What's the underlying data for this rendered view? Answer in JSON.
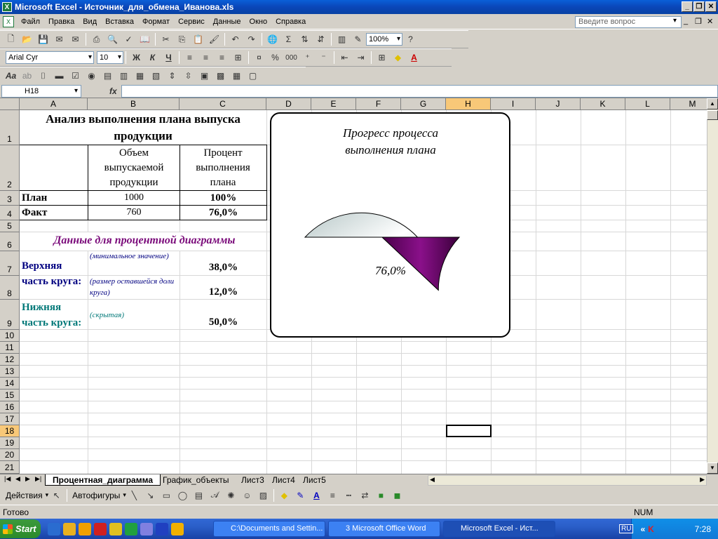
{
  "window": {
    "title": "Microsoft Excel - Источник_для_обмена_Иванова.xls"
  },
  "menu": {
    "items": [
      "Файл",
      "Правка",
      "Вид",
      "Вставка",
      "Формат",
      "Сервис",
      "Данные",
      "Окно",
      "Справка"
    ],
    "help_placeholder": "Введите вопрос"
  },
  "toolbar": {
    "zoom": "100%",
    "font": "Arial Cyr",
    "size": "10",
    "bold": "Ж",
    "italic": "К",
    "underline": "Ч",
    "percent": "%",
    "thousands": "000"
  },
  "formula_bar": {
    "name_box": "H18",
    "fx": "fx",
    "content": ""
  },
  "columns": [
    "A",
    "B",
    "C",
    "D",
    "E",
    "F",
    "G",
    "H",
    "I",
    "J",
    "K",
    "L",
    "M"
  ],
  "rows": [
    "1",
    "2",
    "3",
    "4",
    "5",
    "6",
    "7",
    "8",
    "9",
    "10",
    "11",
    "12",
    "13",
    "14",
    "15",
    "16",
    "17",
    "18",
    "19",
    "20",
    "21"
  ],
  "sheet": {
    "title": "Анализ выполнения плана выпуска продукции",
    "hdr_volume": "Объем выпускаемой продукции",
    "hdr_percent": "Процент выполнения плана",
    "plan_label": "План",
    "plan_value": "1000",
    "plan_pct": "100%",
    "fact_label": "Факт",
    "fact_value": "760",
    "fact_pct": "76,0%",
    "section_title": "Данные для процентной диаграммы",
    "upper_label": "Верхняя часть круга:",
    "upper_note1": "(минимальное значение)",
    "upper_val1": "38,0%",
    "upper_note2": "(размер оставшейся доли круга)",
    "upper_val2": "12,0%",
    "lower_label": "Нижняя часть круга:",
    "lower_note": "(скрытая)",
    "lower_val": "50,0%"
  },
  "chart_data": {
    "type": "pie",
    "title": "Прогресс процесса выполнения плана",
    "slices": [
      {
        "value": 38,
        "color": "#e8eeee"
      },
      {
        "value": 12,
        "color": "#7a0a7a"
      },
      {
        "value": 50,
        "color": "hidden"
      }
    ],
    "start_angle_deg": 180,
    "label": "76,0%"
  },
  "tabs": {
    "items": [
      "Процентная_диаграмма",
      "График_объекты",
      "Лист3",
      "Лист4",
      "Лист5"
    ],
    "active": 0
  },
  "draw": {
    "actions": "Действия",
    "autoshapes": "Автофигуры"
  },
  "status": {
    "left": "Готово",
    "num": "NUM"
  },
  "taskbar": {
    "start": "Start",
    "tasks": [
      "C:\\Documents and Settin...",
      "3 Microsoft Office Word",
      "Microsoft Excel - Ист..."
    ],
    "lang": "RU",
    "time": "7:28"
  }
}
